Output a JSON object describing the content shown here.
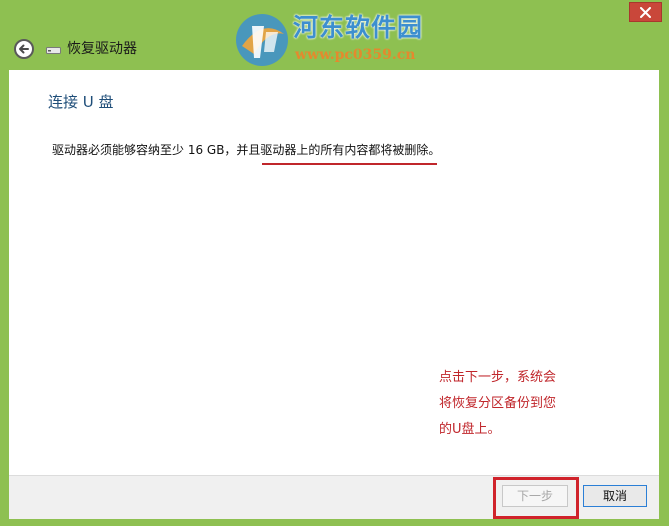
{
  "window": {
    "title": "恢复驱动器"
  },
  "watermark": {
    "name": "河东软件园",
    "url": "www.pc0359.cn"
  },
  "page": {
    "heading": "连接 U 盘",
    "description": "驱动器必须能够容纳至少 16 GB，并且驱动器上的所有内容都将被删除。"
  },
  "annotation": {
    "lines": [
      "点击下一步，系统会",
      "将恢复分区备份到您",
      "的U盘上。"
    ]
  },
  "footer": {
    "next_label": "下一步",
    "cancel_label": "取消"
  },
  "colors": {
    "frame": "#8ec051",
    "close": "#c9473a",
    "heading": "#1f4e79",
    "annotation": "#c0262b",
    "watermark_name": "#3d8fcf",
    "watermark_url": "#e4892e"
  },
  "icons": {
    "close": "close-icon",
    "back": "back-arrow-icon",
    "drive": "drive-icon",
    "logo": "watermark-logo-icon"
  }
}
